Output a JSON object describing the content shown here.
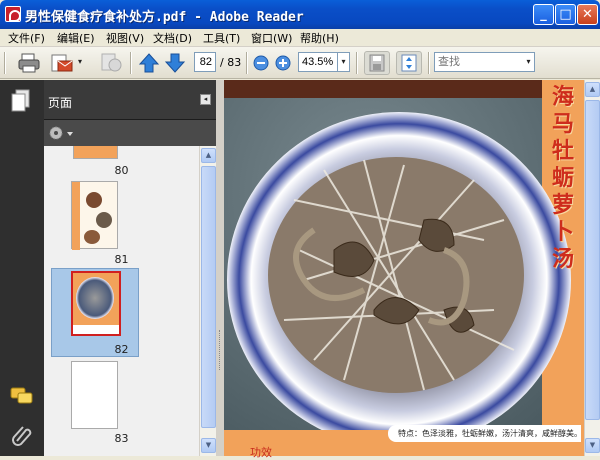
{
  "window": {
    "title": "男性保健食疗食补处方.pdf - Adobe Reader",
    "minimize_glyph": "_",
    "maximize_glyph": "□",
    "close_glyph": "✕"
  },
  "menu": [
    {
      "label": "文件(F)"
    },
    {
      "label": "编辑(E)"
    },
    {
      "label": "视图(V)"
    },
    {
      "label": "文档(D)"
    },
    {
      "label": "工具(T)"
    },
    {
      "label": "窗口(W)"
    },
    {
      "label": "帮助(H)"
    }
  ],
  "toolbar": {
    "page_current": "82",
    "page_total": "/ 83",
    "zoom": "43.5%",
    "search_placeholder": "查找",
    "icons": [
      "print-icon",
      "email-icon",
      "collaborate-icon",
      "previous-page-icon",
      "next-page-icon",
      "zoom-out-icon",
      "zoom-in-icon",
      "save-icon",
      "fit-page-icon"
    ]
  },
  "nav_panel": {
    "title": "页面",
    "collapse_glyph": "◂",
    "options_glyph": "▾",
    "thumbnails": [
      {
        "page": "80",
        "selected": false
      },
      {
        "page": "81",
        "selected": false
      },
      {
        "page": "82",
        "selected": true
      },
      {
        "page": "83",
        "selected": false
      }
    ]
  },
  "document": {
    "recipe_title": "海马牡蛎萝卜汤",
    "caption": "特点：色泽淡雅，牡蛎鲜嫩，汤汁清爽，咸鲜醇美。",
    "bottom_text": "功效"
  },
  "colors": {
    "titlebar": "#0a4fc8",
    "selection": "#a8c8e8",
    "title_red": "#ce2c1c",
    "page_orange": "#f2a25a"
  }
}
